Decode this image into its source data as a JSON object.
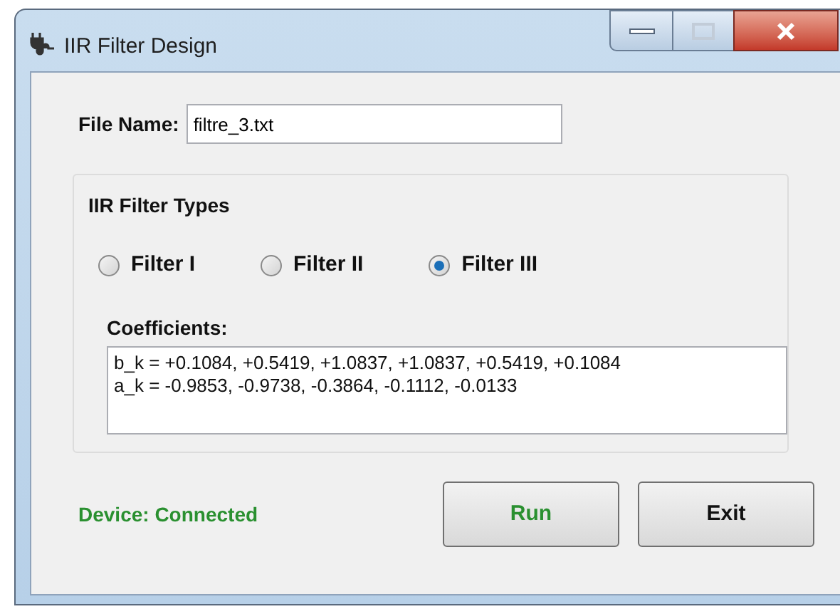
{
  "window": {
    "title": "IIR Filter Design"
  },
  "file_name": {
    "label": "File Name:",
    "value": "filtre_3.txt"
  },
  "filter_types": {
    "title": "IIR Filter Types",
    "options": [
      {
        "label": "Filter I",
        "selected": false
      },
      {
        "label": "Filter II",
        "selected": false
      },
      {
        "label": "Filter III",
        "selected": true
      }
    ]
  },
  "coefficients": {
    "label": "Coefficients:",
    "lines": [
      "b_k = +0.1084, +0.5419, +1.0837, +1.0837, +0.5419, +0.1084",
      "a_k = -0.9853, -0.9738, -0.3864, -0.1112, -0.0133"
    ]
  },
  "status": "Device: Connected",
  "buttons": [
    {
      "label": "Run",
      "kind": "run"
    },
    {
      "label": "Exit",
      "kind": "exit"
    }
  ]
}
